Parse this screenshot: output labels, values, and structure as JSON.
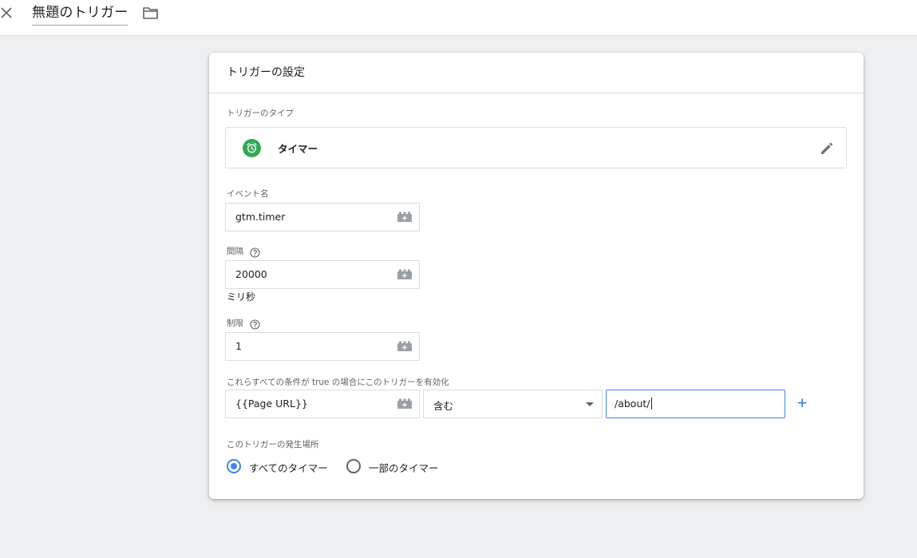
{
  "header": {
    "title": "無題のトリガー"
  },
  "card": {
    "title": "トリガーの設定",
    "trigger_type": {
      "label": "トリガーのタイプ",
      "value": "タイマー",
      "icon": "alarm-clock-icon",
      "icon_color": "#34a853"
    },
    "event_name": {
      "label": "イベント名",
      "value": "gtm.timer"
    },
    "interval": {
      "label": "間隔",
      "value": "20000",
      "unit": "ミリ秒"
    },
    "limit": {
      "label": "制限",
      "value": "1"
    },
    "conditions": {
      "label": "これらすべての条件が true の場合にこのトリガーを有効化",
      "variable": "{{Page URL}}",
      "operator": "含む",
      "value": "/about/",
      "add_label": "+"
    },
    "fire_on": {
      "label": "このトリガーの発生場所",
      "options": [
        {
          "label": "すべてのタイマー",
          "checked": true
        },
        {
          "label": "一部のタイマー",
          "checked": false
        }
      ]
    }
  },
  "colors": {
    "accent": "#4285f4",
    "link": "#1a73e8",
    "background": "#eeeff1"
  }
}
